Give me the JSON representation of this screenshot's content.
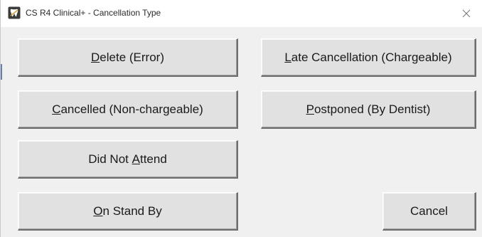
{
  "window": {
    "title": "CS R4 Clinical+ - Cancellation Type"
  },
  "buttons": {
    "delete_error": {
      "mnemonic": "D",
      "rest": "elete (Error)"
    },
    "late_cancellation": {
      "mnemonic": "L",
      "rest": "ate Cancellation (Chargeable)"
    },
    "cancelled_non_chargeable": {
      "mnemonic": "C",
      "rest": "ancelled (Non-chargeable)"
    },
    "postponed_by_dentist": {
      "mnemonic": "P",
      "rest": "ostponed (By Dentist)"
    },
    "did_not_attend": {
      "before": "Did Not ",
      "mnemonic": "A",
      "rest": "ttend"
    },
    "on_stand_by": {
      "mnemonic": "O",
      "rest": "n Stand By"
    },
    "cancel": {
      "label": "Cancel"
    }
  },
  "icons": {
    "app": "tooth-app-icon",
    "close": "close-icon"
  }
}
